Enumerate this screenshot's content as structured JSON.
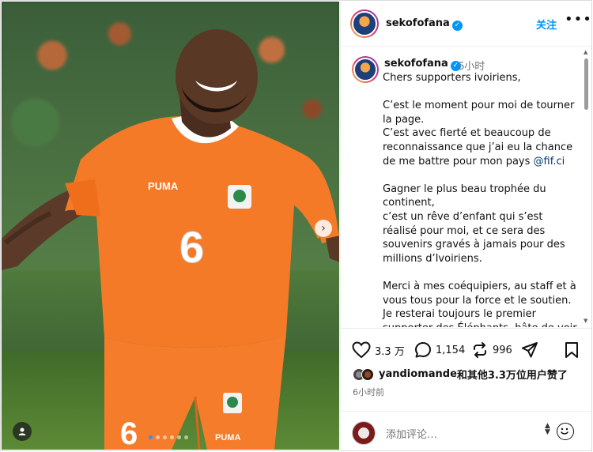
{
  "post": {
    "username": "sekofofana",
    "follow_label": "关注",
    "more_label": "•••",
    "caption_time": "6小时",
    "caption_lines": [
      "Chers supporters ivoiriens,",
      "",
      "C’est le moment pour moi de tourner la page.",
      "C’est avec fierté et beaucoup de reconnaissance que j’ai eu la chance de me battre pour mon pays ",
      "",
      "Gagner le plus beau trophée du continent,",
      "c’est un rêve d’enfant qui s’est réalisé pour moi, et ce sera des souvenirs gravés à jamais pour des millions d’Ivoiriens.",
      "",
      "Merci à mes coéquipiers, au staff et à vous tous pour la force et le soutien.",
      "Je resterai toujours le premier supporter des Éléphants, hâte de voir"
    ],
    "mention": "@fif.ci"
  },
  "photo": {
    "jersey_number": "6",
    "brand": "PUMA",
    "carousel_count": 6,
    "carousel_active": 0
  },
  "actions": {
    "likes": "3.3 万",
    "comments": "1,154",
    "reposts": "996"
  },
  "liked_by": {
    "user": "yandiomande",
    "suffix": "和其他3.3万位用户赞了"
  },
  "time_ago": "6小时前",
  "comment_placeholder": "添加评论…",
  "icons": {
    "verified": "verified-badge-icon",
    "heart": "heart-icon",
    "comment": "comment-icon",
    "repost": "repost-icon",
    "share": "share-icon",
    "bookmark": "bookmark-icon",
    "emoji": "emoji-icon",
    "person": "person-tag-icon",
    "next": "chevron-right-icon"
  },
  "colors": {
    "accent": "#0095f6",
    "jersey": "#f57c2a",
    "text": "#111111",
    "muted": "#737373"
  }
}
